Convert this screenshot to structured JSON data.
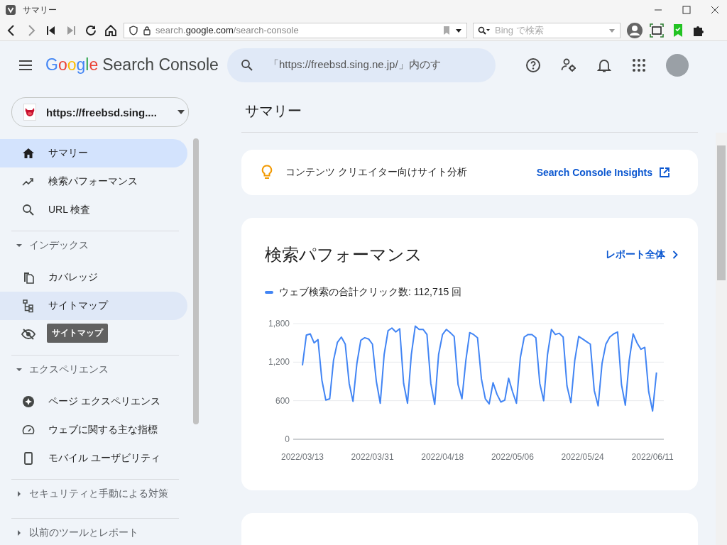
{
  "browser": {
    "title": "サマリー",
    "address": [
      {
        "text": "search.",
        "emphasis": false
      },
      {
        "text": "google.com",
        "emphasis": true
      },
      {
        "text": "/search-console",
        "emphasis": false
      }
    ],
    "search_placeholder": "Bing で検索"
  },
  "header": {
    "logo_google": "Google",
    "logo_product": "Search Console",
    "search_placeholder": "「https://freebsd.sing.ne.jp/」内のす"
  },
  "property": {
    "url": "https://freebsd.sing...."
  },
  "sidebar": {
    "groups": [
      {
        "items": [
          {
            "label": "サマリー",
            "selected": true,
            "hovered": false
          },
          {
            "label": "検索パフォーマンス",
            "selected": false,
            "hovered": false
          },
          {
            "label": "URL 検査",
            "selected": false,
            "hovered": false
          }
        ]
      },
      {
        "title": "インデックス",
        "expanded": true,
        "items": [
          {
            "label": "カバレッジ",
            "selected": false,
            "hovered": false
          },
          {
            "label": "サイトマップ",
            "selected": false,
            "hovered": true
          },
          {
            "selected": false,
            "hovered": false
          }
        ]
      },
      {
        "title": "エクスペリエンス",
        "expanded": true,
        "items": [
          {
            "label": "ページ エクスペリエンス",
            "selected": false,
            "hovered": false
          },
          {
            "label": "ウェブに関する主な指標",
            "selected": false,
            "hovered": false
          },
          {
            "label": "モバイル ユーザビリティ",
            "selected": false,
            "hovered": false
          }
        ]
      },
      {
        "title": "セキュリティと手動による対策",
        "expanded": false
      },
      {
        "title": "以前のツールとレポート",
        "expanded": false
      }
    ]
  },
  "tooltip": "サイトマップ",
  "main": {
    "title": "サマリー",
    "insights": {
      "text": "コンテンツ クリエイター向けサイト分析",
      "link": "Search Console Insights"
    },
    "performance": {
      "title": "検索パフォーマンス",
      "link": "レポート全体",
      "legend_suffix": ": 112,715 回",
      "chart_data": {
        "type": "line",
        "categories": [
          "2022/03/13",
          null,
          null,
          null,
          null,
          null,
          null,
          null,
          null,
          null,
          null,
          null,
          null,
          null,
          null,
          null,
          null,
          null,
          "2022/03/31",
          null,
          null,
          null,
          null,
          null,
          null,
          null,
          null,
          null,
          null,
          null,
          null,
          null,
          null,
          null,
          null,
          null,
          "2022/04/18",
          null,
          null,
          null,
          null,
          null,
          null,
          null,
          null,
          null,
          null,
          null,
          null,
          null,
          null,
          null,
          null,
          null,
          "2022/05/06",
          null,
          null,
          null,
          null,
          null,
          null,
          null,
          null,
          null,
          null,
          null,
          null,
          null,
          null,
          null,
          null,
          null,
          "2022/05/24",
          null,
          null,
          null,
          null,
          null,
          null,
          null,
          null,
          null,
          null,
          null,
          null,
          null,
          null,
          null,
          null,
          null,
          "2022/06/11",
          null
        ],
        "series": [
          {
            "name": "ウェブ検索の合計クリック数",
            "color": "#4285f4",
            "values": [
              1150,
              1620,
              1640,
              1500,
              1550,
              920,
              610,
              630,
              1230,
              1510,
              1590,
              1480,
              870,
              590,
              1180,
              1540,
              1580,
              1560,
              1480,
              900,
              560,
              1320,
              1690,
              1730,
              1670,
              1720,
              870,
              560,
              1320,
              1760,
              1710,
              1710,
              1630,
              870,
              540,
              1320,
              1630,
              1710,
              1660,
              1600,
              850,
              630,
              1230,
              1660,
              1630,
              1580,
              940,
              630,
              550,
              880,
              700,
              580,
              610,
              950,
              740,
              560,
              1270,
              1590,
              1630,
              1630,
              1580,
              870,
              600,
              1320,
              1710,
              1630,
              1650,
              1590,
              830,
              570,
              1230,
              1600,
              1560,
              1520,
              1480,
              760,
              520,
              1180,
              1480,
              1590,
              1640,
              1670,
              850,
              530,
              1230,
              1640,
              1500,
              1400,
              1430,
              740,
              440,
              1040
            ]
          }
        ],
        "yticks": [
          {
            "value": 0,
            "label": "0"
          },
          {
            "value": 600,
            "label": "600"
          },
          {
            "value": 1200,
            "label": "1,200"
          },
          {
            "value": 1800,
            "label": "1,800"
          }
        ],
        "ylim": [
          0,
          1800
        ]
      }
    }
  }
}
